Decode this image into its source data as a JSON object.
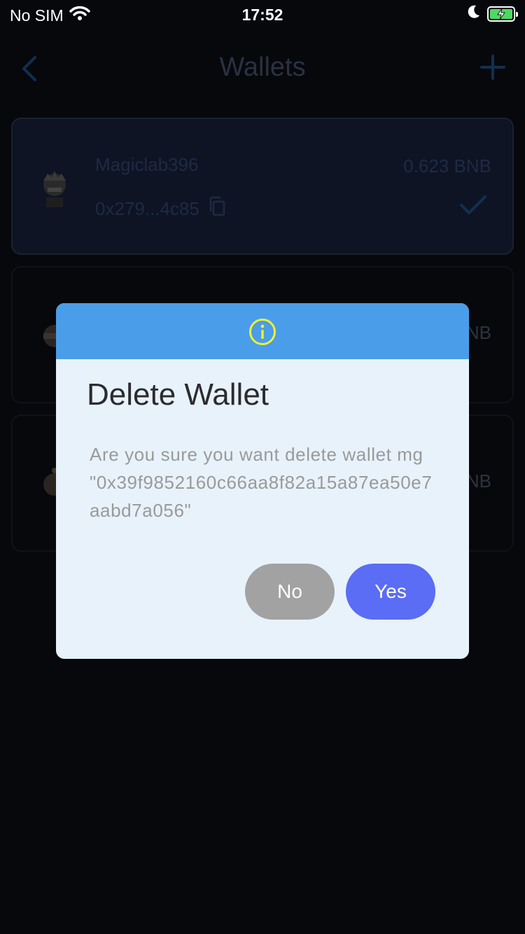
{
  "status_bar": {
    "carrier": "No SIM",
    "time": "17:52",
    "icons": [
      "wifi-icon",
      "moon-icon",
      "battery-charging-icon"
    ]
  },
  "nav": {
    "title": "Wallets",
    "back_icon": "chevron-left-icon",
    "add_icon": "plus-icon"
  },
  "wallets": [
    {
      "name": "Magiclab396",
      "balance": "0.623 BNB",
      "address_short": "0x279...4c85",
      "copy_icon": "copy-icon",
      "selected_icon": "checkmark-icon"
    },
    {
      "balance_partial": "NB"
    },
    {
      "balance_partial": "NB"
    }
  ],
  "dialog": {
    "icon": "info-icon",
    "title": "Delete Wallet",
    "message": "Are you sure you want delete wallet mg \"0x39f9852160c66aa8f82a15a87ea50e7aabd7a056\"",
    "no_label": "No",
    "yes_label": "Yes"
  },
  "colors": {
    "background": "#07080c",
    "dialog_header": "#4a9de8",
    "dialog_body": "#e8f2fb",
    "info_icon": "#f3f02a",
    "yes_button": "#5b6cf5",
    "no_button": "#a2a2a2"
  }
}
